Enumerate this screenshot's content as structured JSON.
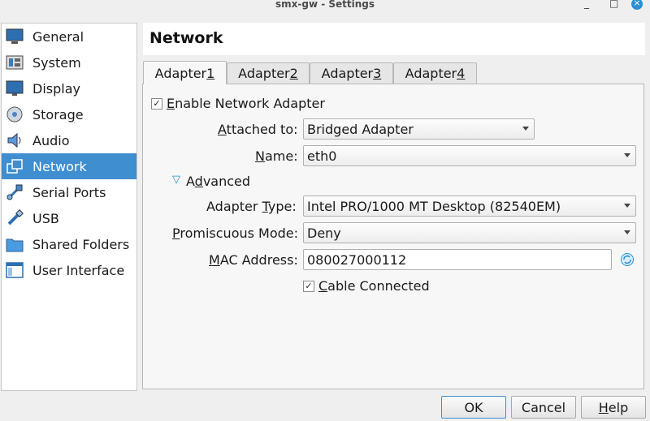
{
  "window": {
    "title": "smx-gw - Settings",
    "min": "_",
    "max": "□",
    "close": "×"
  },
  "sidebar": {
    "items": [
      {
        "label": "General",
        "icon": "general-icon"
      },
      {
        "label": "System",
        "icon": "system-icon"
      },
      {
        "label": "Display",
        "icon": "display-icon"
      },
      {
        "label": "Storage",
        "icon": "storage-icon"
      },
      {
        "label": "Audio",
        "icon": "audio-icon"
      },
      {
        "label": "Network",
        "icon": "network-icon",
        "selected": true
      },
      {
        "label": "Serial Ports",
        "icon": "serial-ports-icon"
      },
      {
        "label": "USB",
        "icon": "usb-icon"
      },
      {
        "label": "Shared Folders",
        "icon": "shared-folders-icon"
      },
      {
        "label": "User Interface",
        "icon": "user-interface-icon"
      }
    ]
  },
  "page": {
    "title": "Network"
  },
  "tabs": [
    {
      "prefix": "Adapter ",
      "mnemonic": "1"
    },
    {
      "prefix": "Adapter ",
      "mnemonic": "2"
    },
    {
      "prefix": "Adapter ",
      "mnemonic": "3"
    },
    {
      "prefix": "Adapter ",
      "mnemonic": "4"
    }
  ],
  "adapter": {
    "enable": {
      "mnemonic": "E",
      "rest": "nable Network Adapter",
      "checked": "✓"
    },
    "attached": {
      "mnemonic": "A",
      "rest": "ttached to:",
      "value": "Bridged Adapter"
    },
    "name": {
      "mnemonic": "N",
      "rest": "ame:",
      "value": "eth0"
    },
    "advanced": {
      "pre": "A",
      "mnemonic": "d",
      "rest": "vanced",
      "toggle": "▽"
    },
    "type": {
      "pre": "Adapter ",
      "mnemonic": "T",
      "rest": "ype:",
      "value": "Intel PRO/1000 MT Desktop (82540EM)"
    },
    "promiscuous": {
      "mnemonic": "P",
      "rest": "romiscuous Mode:",
      "value": "Deny"
    },
    "mac": {
      "mnemonic": "M",
      "rest": "AC Address:",
      "value": "080027000112"
    },
    "cable": {
      "mnemonic": "C",
      "rest": "able Connected",
      "checked": "✓"
    }
  },
  "buttons": {
    "ok": "OK",
    "cancel": "Cancel",
    "help_mnemonic": "H",
    "help_rest": "elp"
  }
}
